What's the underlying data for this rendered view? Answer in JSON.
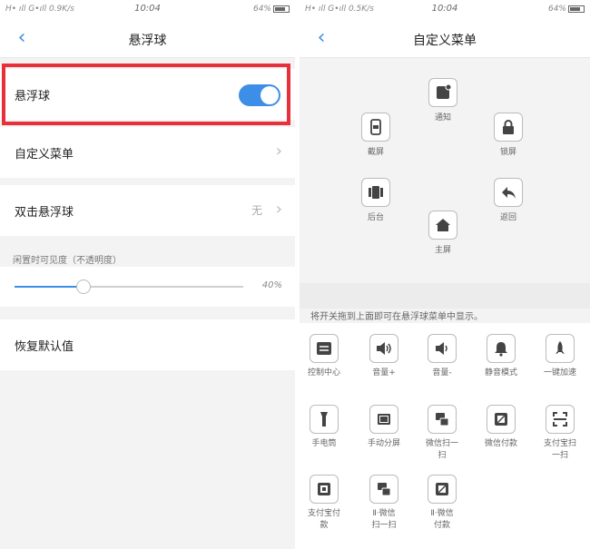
{
  "status_left": {
    "signal": "H• ıll G•ıll 0.9K/s",
    "time": "10:04",
    "battery": "64%"
  },
  "status_right": {
    "signal": "H• ıll G•ıll 0.5K/s",
    "time": "10:04",
    "battery": "64%"
  },
  "left": {
    "title": "悬浮球",
    "rows": {
      "ball": "悬浮球",
      "custom_menu": "自定义菜单",
      "double_tap": "双击悬浮球",
      "double_tap_value": "无",
      "restore": "恢复默认值"
    },
    "toggle_on": true,
    "opacity_caption": "闲置时可见度（不透明度）",
    "opacity_value": "40%",
    "opacity_fraction": 0.3
  },
  "right": {
    "title": "自定义菜单",
    "fan_items": {
      "notify": "通知",
      "screenshot": "截屏",
      "lock": "锁屏",
      "multitask": "后台",
      "back": "返回",
      "home": "主屏"
    },
    "hint": "将开关拖到上面即可在悬浮球菜单中显示。",
    "tools": {
      "control_center": "控制中心",
      "vol_up": "音量+",
      "vol_down": "音量-",
      "silent": "静音模式",
      "boost": "一键加速",
      "flashlight": "手电筒",
      "manual_split": "手动分屏",
      "wechat_scan": "微信扫一扫",
      "wechat_pay": "微信付款",
      "alipay_scan": "支付宝扫一扫",
      "alipay_pay": "支付宝付款",
      "clone_wechat_scan": "Ⅱ·微信扫一扫",
      "clone_wechat_pay": "Ⅱ·微信付款"
    }
  }
}
